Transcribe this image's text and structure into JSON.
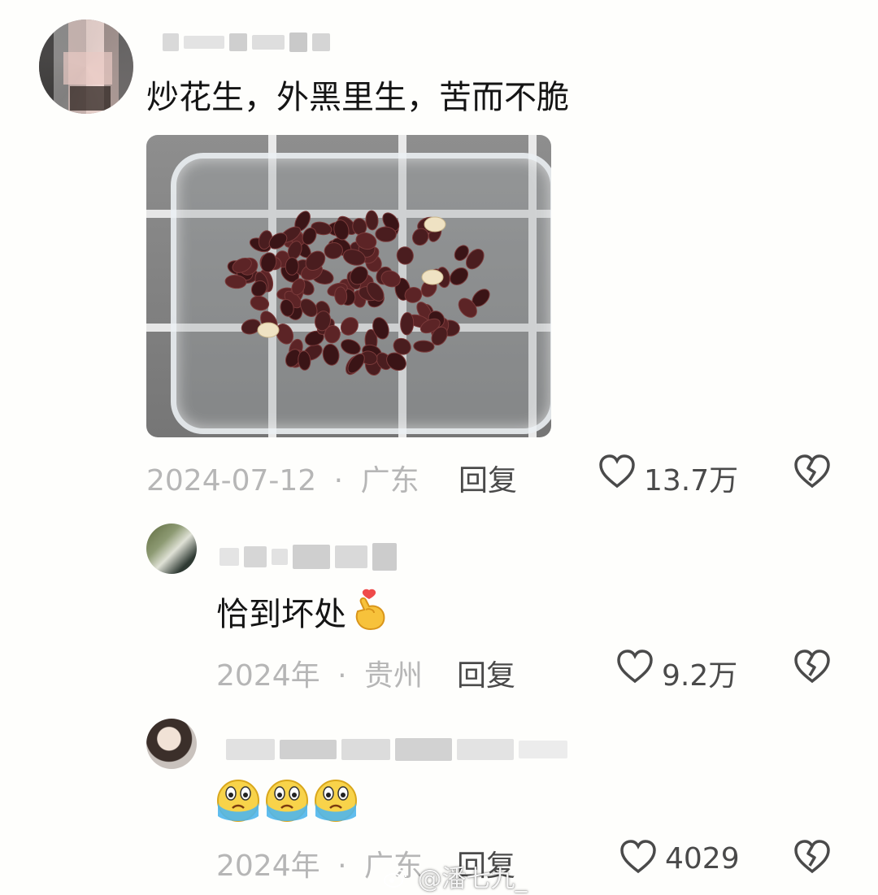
{
  "comments": [
    {
      "text": "炒花生，外黑里生，苦而不脆",
      "date": "2024-07-12",
      "separator": "·",
      "location": "广东",
      "reply_label": "回复",
      "likes": "13.7万"
    },
    {
      "text": "恰到坏处",
      "date": "2024年",
      "separator": "·",
      "location": "贵州",
      "reply_label": "回复",
      "likes": "9.2万"
    },
    {
      "text": "",
      "date": "2024年",
      "separator": "·",
      "location": "广东",
      "reply_label": "回复",
      "likes": "4029"
    }
  ],
  "icons": {
    "like": "heart-outline-icon",
    "dislike": "broken-heart-icon",
    "emoji_heart_hands": "finger-heart-emoji-icon",
    "emoji_cry": "crying-face-emoji-icon"
  },
  "watermark": {
    "text": "@潘七九_"
  },
  "colors": {
    "background": "#fefefc",
    "text": "#141414",
    "meta": "#b6b6b6",
    "action": "#4a4a4a"
  }
}
